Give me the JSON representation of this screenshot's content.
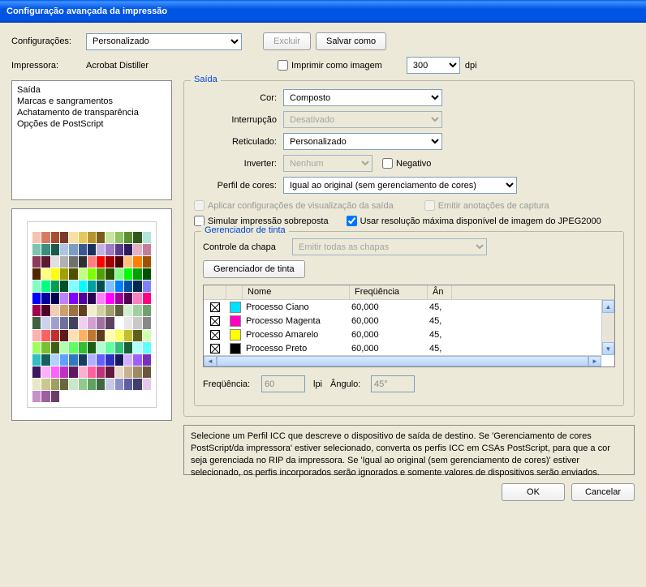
{
  "window": {
    "title": "Configuração avançada da impressão"
  },
  "top": {
    "config_label": "Configurações:",
    "config_value": "Personalizado",
    "delete_btn": "Excluir",
    "saveas_btn": "Salvar como",
    "printer_label": "Impressora:",
    "printer_value": "Acrobat Distiller",
    "print_as_image": "Imprimir como imagem",
    "dpi_value": "300",
    "dpi_unit": "dpi"
  },
  "categories": [
    "Saída",
    "Marcas e sangramentos",
    "Achatamento de transparência",
    "Opções de PostScript"
  ],
  "saida": {
    "legend": "Saída",
    "cor_label": "Cor:",
    "cor_value": "Composto",
    "interrup_label": "Interrupção",
    "interrup_value": "Desativado",
    "retic_label": "Reticulado:",
    "retic_value": "Personalizado",
    "inverter_label": "Inverter:",
    "inverter_value": "Nenhum",
    "negativo": "Negativo",
    "perfil_label": "Perfil de cores:",
    "perfil_value": "Igual ao original (sem gerenciamento de cores)",
    "aplicar_viz": "Aplicar configurações de visualização da saída",
    "emitir_anot": "Emitir anotações de captura",
    "simular": "Simular impressão sobreposta",
    "usar_res": "Usar resolução máxima disponível de imagem do JPEG2000"
  },
  "ink": {
    "legend": "Gerenciador de tinta",
    "controle_label": "Controle da chapa",
    "controle_value": "Emitir todas as chapas",
    "manager_btn": "Gerenciador de tinta",
    "headers": {
      "nome": "Nome",
      "freq": "Freqüência",
      "ang": "Ân"
    },
    "rows": [
      {
        "name": "Processo Ciano",
        "color": "#00e0ff",
        "freq": "60,000",
        "ang": "45,"
      },
      {
        "name": "Processo Magenta",
        "color": "#ff00c0",
        "freq": "60,000",
        "ang": "45,"
      },
      {
        "name": "Processo Amarelo",
        "color": "#ffff00",
        "freq": "60,000",
        "ang": "45,"
      },
      {
        "name": "Processo Preto",
        "color": "#000000",
        "freq": "60,000",
        "ang": "45,"
      }
    ],
    "freq_label": "Freqüência:",
    "freq_value": "60",
    "lpi": "lpi",
    "ang_label": "Ângulo:",
    "ang_value": "45°"
  },
  "help": "Selecione um Perfil ICC que descreve o dispositivo de saída de destino. Se 'Gerenciamento de cores PostScript/da impressora' estiver selecionado, converta os perfis ICC em CSAs PostScript, para que a cor seja gerenciada no RIP da impressora. Se 'Igual ao original (sem gerenciamento de cores)' estiver selecionado, os perfis incorporados serão ignorados e somente valores de dispositivos serão enviados.",
  "footer": {
    "ok": "OK",
    "cancel": "Cancelar"
  },
  "swatch_colors": [
    "#f7c3b0",
    "#d97b62",
    "#a94d33",
    "#7c3a2a",
    "#f9e0a0",
    "#e6c85a",
    "#b8942f",
    "#7a5d1a",
    "#c5e6a0",
    "#8fc561",
    "#5a8f33",
    "#2f5a1a",
    "#b0e6d9",
    "#7cc5b0",
    "#3a8f7c",
    "#1a5a4d",
    "#b0c5e6",
    "#7c9bc5",
    "#3a5a8f",
    "#1a2f5a",
    "#c5b0e6",
    "#9b7cc5",
    "#5a3a8f",
    "#2f1a5a",
    "#e6b0c5",
    "#c57c9b",
    "#8f3a5a",
    "#5a1a2f",
    "#e0e0e0",
    "#b0b0b0",
    "#707070",
    "#303030",
    "#ff8080",
    "#ff0000",
    "#a00000",
    "#500000",
    "#ffc080",
    "#ff8000",
    "#a05000",
    "#502800",
    "#ffff80",
    "#ffff00",
    "#a0a000",
    "#505000",
    "#c0ff80",
    "#80ff00",
    "#50a000",
    "#285000",
    "#80ff80",
    "#00ff00",
    "#00a000",
    "#005000",
    "#80ffc0",
    "#00ff80",
    "#00a050",
    "#005028",
    "#80ffff",
    "#00ffff",
    "#00a0a0",
    "#005050",
    "#80c0ff",
    "#0080ff",
    "#0050a0",
    "#002850",
    "#8080ff",
    "#0000ff",
    "#0000a0",
    "#000050",
    "#c080ff",
    "#8000ff",
    "#5000a0",
    "#280050",
    "#ff80ff",
    "#ff00ff",
    "#a000a0",
    "#500050",
    "#ff80c0",
    "#ff0080",
    "#a00050",
    "#500028",
    "#f0d0b0",
    "#d0a070",
    "#a07040",
    "#604020",
    "#f0f0d0",
    "#d0d0a0",
    "#a0a070",
    "#606040",
    "#d0f0d0",
    "#a0d0a0",
    "#70a070",
    "#406040",
    "#d0d0f0",
    "#a0a0d0",
    "#7070a0",
    "#404060",
    "#f0d0f0",
    "#d0a0d0",
    "#a070a0",
    "#604060",
    "#ffffff",
    "#e8e8e8",
    "#c8c8c8",
    "#888888",
    "#ffb0b0",
    "#ff6060",
    "#c03030",
    "#601818",
    "#ffe0b0",
    "#ffb060",
    "#c07830",
    "#603c18",
    "#ffffb0",
    "#ffff60",
    "#c0c030",
    "#606018",
    "#d0ffb0",
    "#a0ff60",
    "#78c030",
    "#3c6018",
    "#b0ffb0",
    "#60ff60",
    "#30c030",
    "#186018",
    "#b0ffd0",
    "#60ffa0",
    "#30c078",
    "#18603c",
    "#b0ffff",
    "#60ffff",
    "#30c0c0",
    "#186060",
    "#b0d0ff",
    "#60a0ff",
    "#3078c0",
    "#183c60",
    "#b0b0ff",
    "#6060ff",
    "#3030c0",
    "#181860",
    "#d0b0ff",
    "#a060ff",
    "#7830c0",
    "#3c1860",
    "#ffb0ff",
    "#ff60ff",
    "#c030c0",
    "#601860",
    "#ffb0d0",
    "#ff60a0",
    "#c03078",
    "#60183c",
    "#e8d8c8",
    "#c8b090",
    "#a08860",
    "#685840",
    "#e8e8c8",
    "#c8c890",
    "#a0a060",
    "#686840",
    "#c8e8c8",
    "#90c890",
    "#60a060",
    "#406840",
    "#c8c8e8",
    "#9090c8",
    "#6060a0",
    "#404068",
    "#e8c8e8",
    "#c890c8",
    "#a060a0",
    "#684068"
  ]
}
